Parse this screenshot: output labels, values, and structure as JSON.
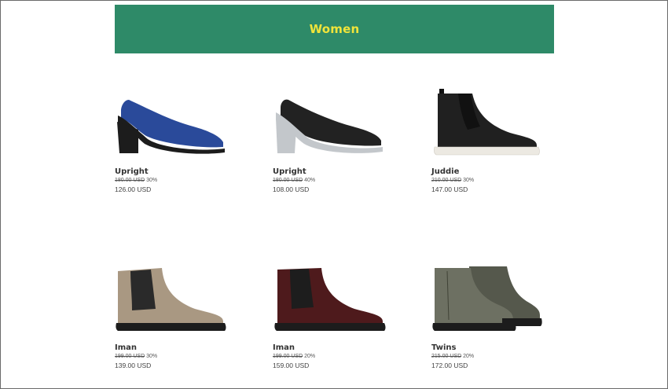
{
  "banner": {
    "title": "Women"
  },
  "products": [
    {
      "name": "Upright",
      "old_price": "180.00 USD",
      "discount": "30%",
      "price": "126.00 USD",
      "icon": "pump-shoe-blue-icon",
      "colors": {
        "upper": "#2a4a9a",
        "sole": "#1c1c1c",
        "heel": "#1c1c1c"
      }
    },
    {
      "name": "Upright",
      "old_price": "180.00 USD",
      "discount": "40%",
      "price": "108.00 USD",
      "icon": "pump-shoe-black-icon",
      "colors": {
        "upper": "#222222",
        "sole": "#c3c7cb",
        "heel": "#c3c7cb"
      }
    },
    {
      "name": "Juddie",
      "old_price": "210.00 USD",
      "discount": "30%",
      "price": "147.00 USD",
      "icon": "chelsea-boot-black-icon",
      "colors": {
        "upper": "#202020",
        "elastic": "#111111",
        "sole": "#ece9e2"
      }
    },
    {
      "name": "Iman",
      "old_price": "199.00 USD",
      "discount": "30%",
      "price": "139.00 USD",
      "icon": "chelsea-boot-taupe-icon",
      "colors": {
        "upper": "#a99882",
        "elastic": "#2a2a2a",
        "sole": "#1c1c1c"
      }
    },
    {
      "name": "Iman",
      "old_price": "199.00 USD",
      "discount": "20%",
      "price": "159.00 USD",
      "icon": "chelsea-boot-burgundy-icon",
      "colors": {
        "upper": "#4e1a1c",
        "elastic": "#1d1d1d",
        "sole": "#1c1c1c"
      }
    },
    {
      "name": "Twins",
      "old_price": "215.00 USD",
      "discount": "20%",
      "price": "172.00 USD",
      "icon": "ankle-boot-olive-icon",
      "colors": {
        "upper": "#6d7062",
        "elastic": "#55584c",
        "sole": "#1c1c1c"
      }
    }
  ]
}
